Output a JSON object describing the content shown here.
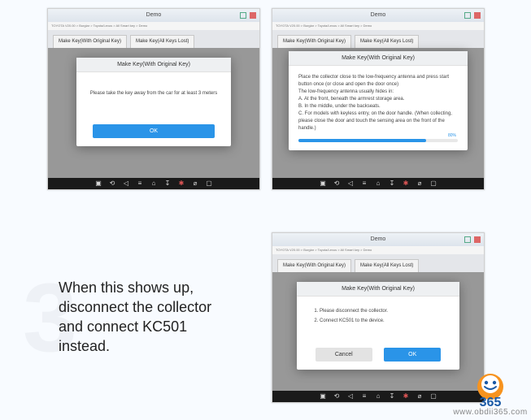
{
  "demo_title": "Demo",
  "crumb": "TOYOTA V20.00 > Burglar > Toyota/Lexus > All Smart key > Demo",
  "tab1": "Make Key(With Original Key)",
  "tab2": "Make Key(All Keys Lost)",
  "dialog_title": "Make Key(With Original Key)",
  "instruction_text": "When this shows up, disconnect the collector and connect KC501 instead.",
  "panelA": {
    "body": "Please take the key away from the car for at least 3 meters",
    "ok": "OK"
  },
  "panelB": {
    "lines": [
      "Place the collector close to the low-frequency antenna and press start button once (or close and open the door once)",
      "The low-frequency antenna usually hides in:",
      "A. At the front, beneath the armrest storage area.",
      "B. In the middle, under the backseats.",
      "C. For models with keyless entry, on the door handle. (When collecting, please close the door and touch the sensing area on the front of the handle.)"
    ],
    "pct": "80%"
  },
  "panelC": {
    "item1": "Please disconnect the collector.",
    "item2": "Connect KC501 to the device.",
    "cancel": "Cancel",
    "ok": "OK"
  },
  "step_number": "3",
  "logo_top": "365",
  "logo_url": "www.obdii365.com"
}
